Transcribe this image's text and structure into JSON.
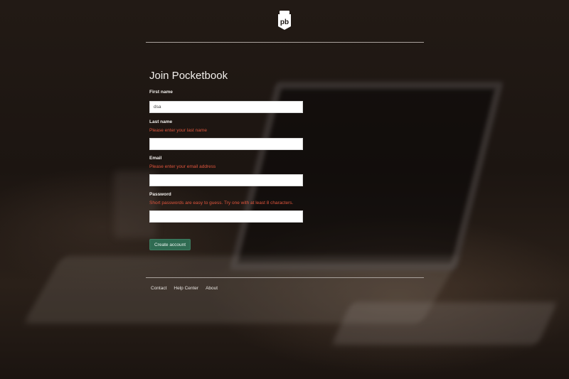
{
  "header": {
    "logo_text": "pb",
    "logo_icon": "pocketbook-logo-icon"
  },
  "form": {
    "title": "Join Pocketbook",
    "fields": [
      {
        "label": "First name",
        "value": "dsa",
        "error": ""
      },
      {
        "label": "Last name",
        "value": "",
        "error": "Please enter your last name"
      },
      {
        "label": "Email",
        "value": "",
        "error": "Please enter your email address"
      },
      {
        "label": "Password",
        "value": "",
        "error": "Short passwords are easy to guess. Try one with at least 8 characters."
      }
    ],
    "submit_label": "Create account"
  },
  "footer": {
    "links": [
      "Contact",
      "Help Center",
      "About"
    ]
  },
  "colors": {
    "accent": "#2f6b52",
    "error": "#e0553d",
    "text": "#f2efec"
  }
}
